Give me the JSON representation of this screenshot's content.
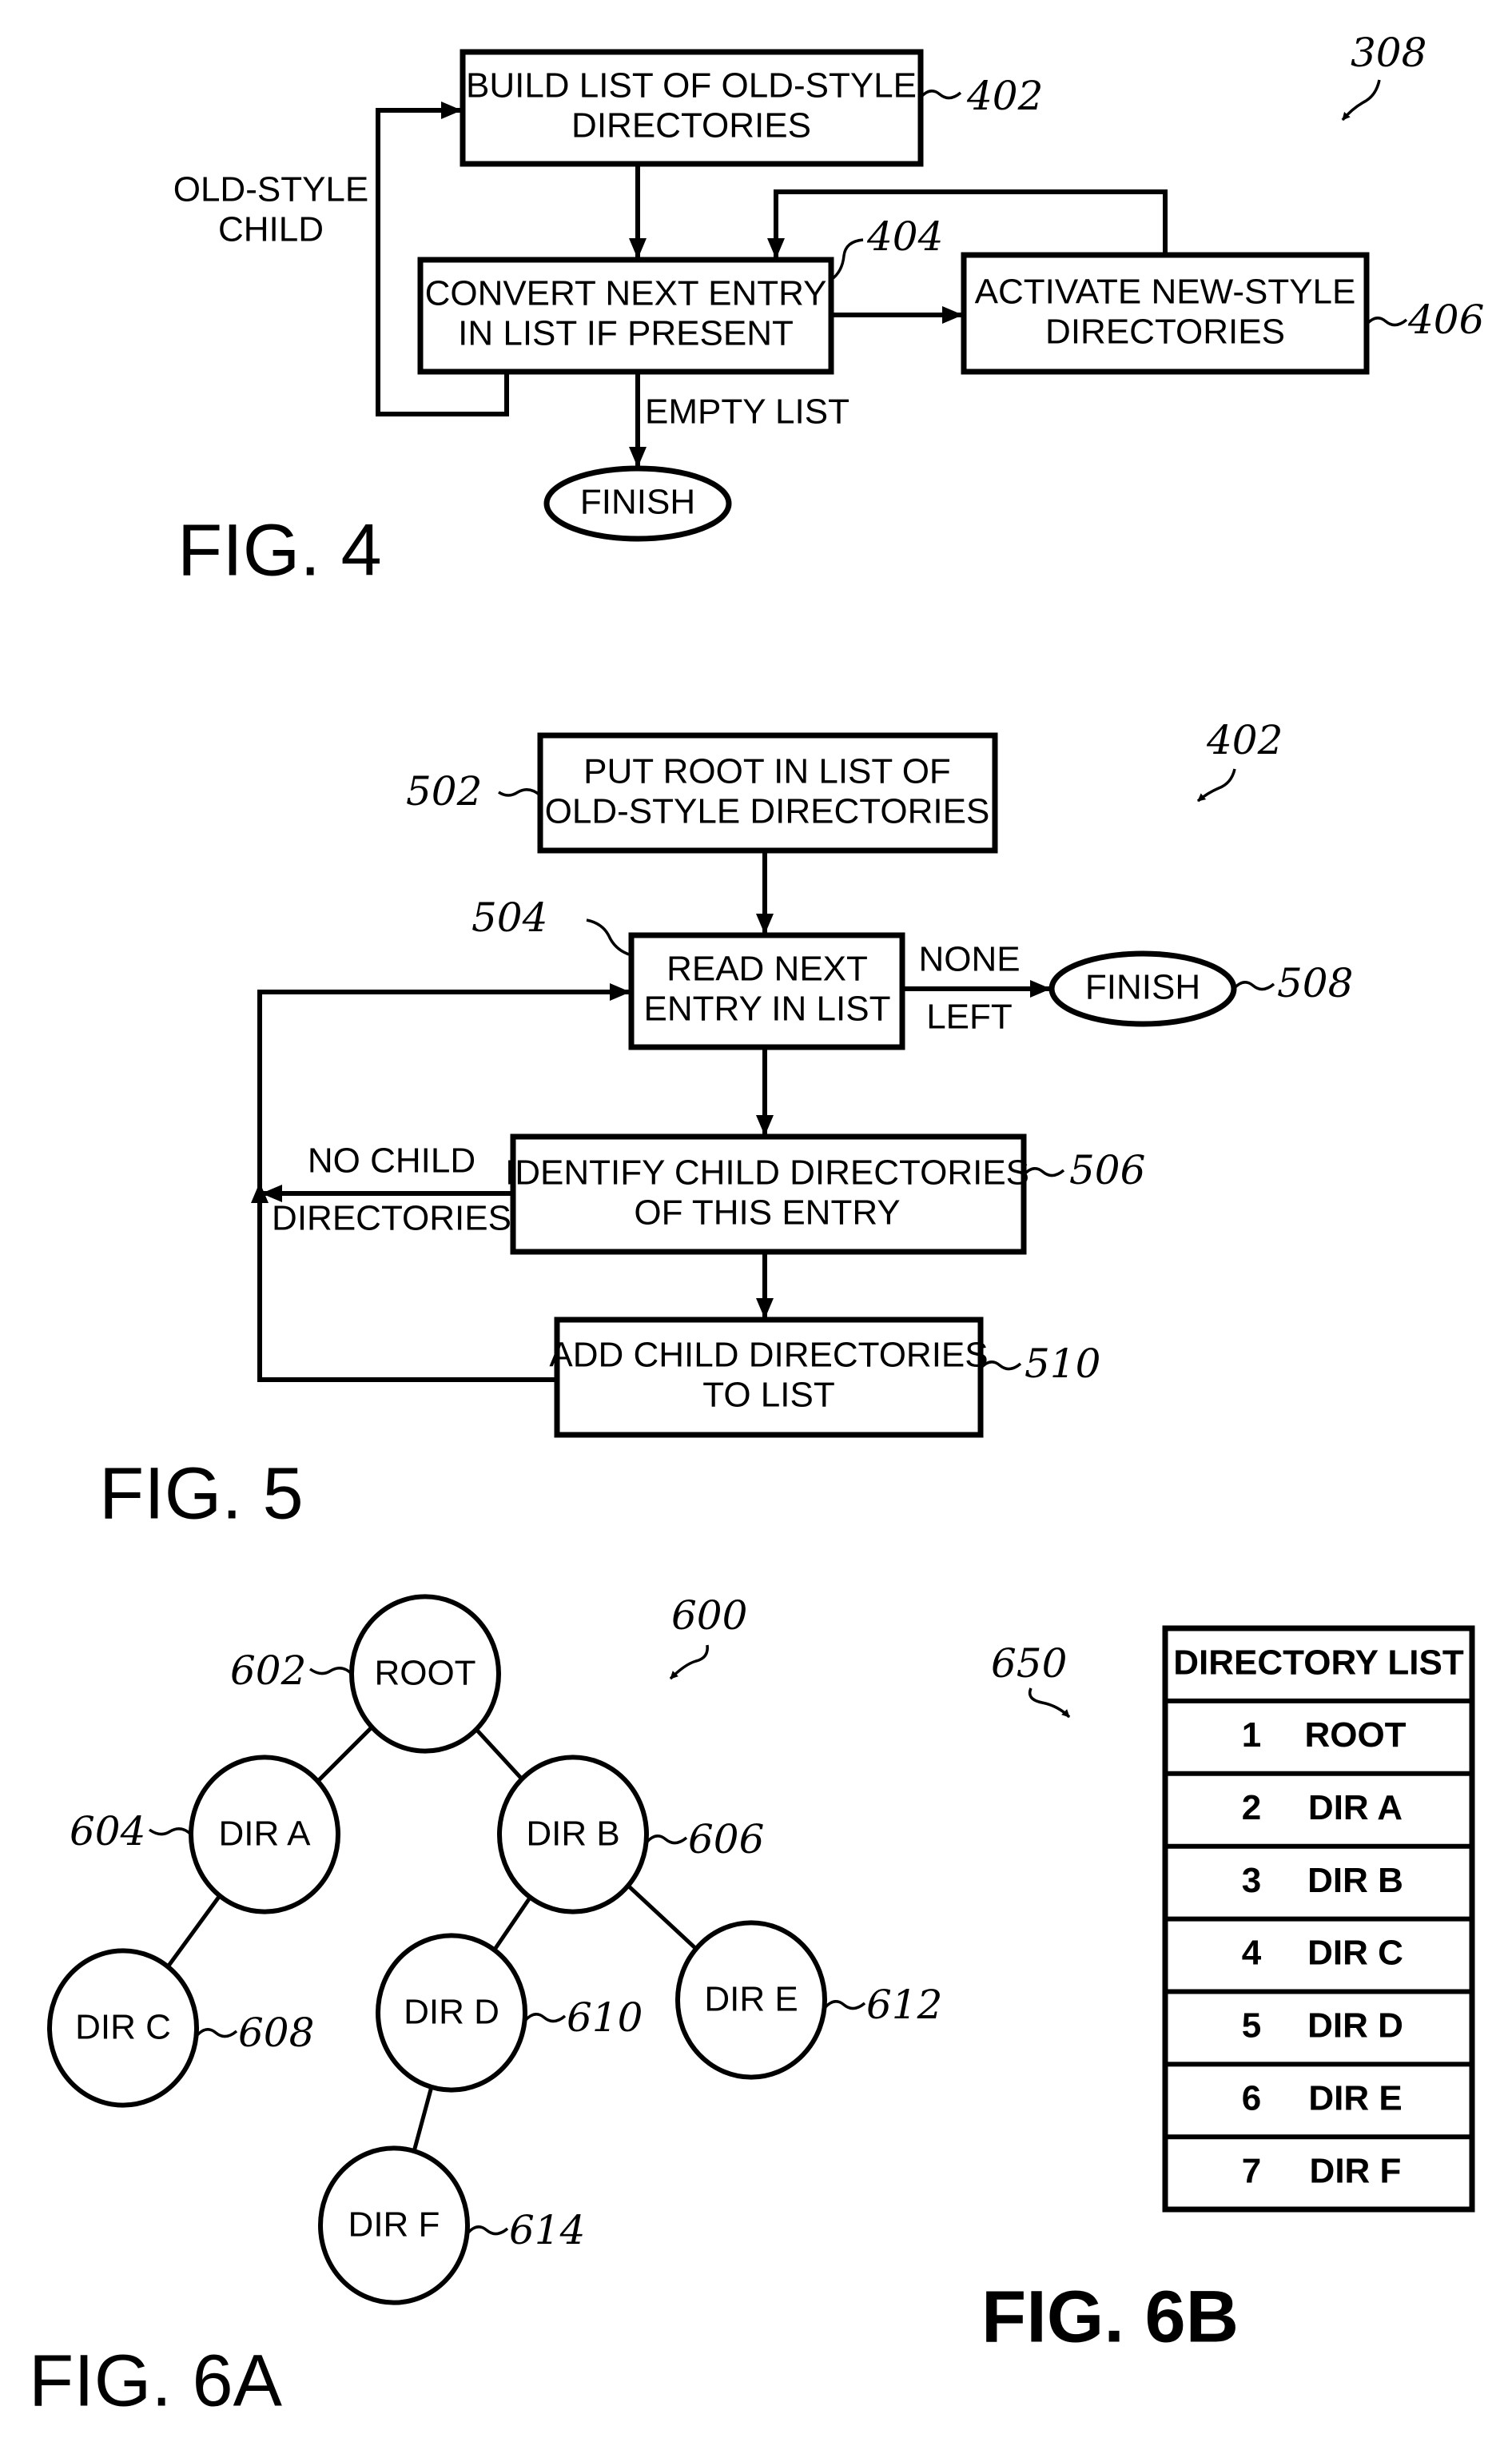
{
  "fig4": {
    "title": "FIG. 4",
    "ref": "308",
    "boxes": {
      "build": {
        "ref": "402",
        "lines": [
          "BUILD LIST OF OLD-STYLE",
          "DIRECTORIES"
        ]
      },
      "convert": {
        "ref": "404",
        "lines": [
          "CONVERT NEXT ENTRY",
          "IN LIST IF PRESENT"
        ]
      },
      "activate": {
        "ref": "406",
        "lines": [
          "ACTIVATE NEW-STYLE",
          "DIRECTORIES"
        ]
      }
    },
    "terminal": "FINISH",
    "edge_labels": {
      "loop": [
        "OLD-STYLE",
        "CHILD"
      ],
      "empty": "EMPTY LIST"
    }
  },
  "fig5": {
    "title": "FIG. 5",
    "ref": "402",
    "boxes": {
      "put_root": {
        "ref": "502",
        "lines": [
          "PUT ROOT IN LIST OF",
          "OLD-STYLE DIRECTORIES"
        ]
      },
      "read_next": {
        "ref": "504",
        "lines": [
          "READ NEXT",
          "ENTRY IN LIST"
        ]
      },
      "identify": {
        "ref": "506",
        "lines": [
          "IDENTIFY CHILD DIRECTORIES",
          "OF THIS ENTRY"
        ]
      },
      "add_child": {
        "ref": "510",
        "lines": [
          "ADD CHILD DIRECTORIES",
          "TO LIST"
        ]
      }
    },
    "terminal": {
      "ref": "508",
      "label": "FINISH"
    },
    "edge_labels": {
      "none_left": [
        "NONE",
        "LEFT"
      ],
      "no_child": [
        "NO CHILD",
        "DIRECTORIES"
      ]
    }
  },
  "fig6a": {
    "title": "FIG. 6A",
    "ref": "600",
    "nodes": [
      {
        "id": "root",
        "label": "ROOT",
        "ref": "602"
      },
      {
        "id": "a",
        "label": "DIR A",
        "ref": "604"
      },
      {
        "id": "b",
        "label": "DIR B",
        "ref": "606"
      },
      {
        "id": "c",
        "label": "DIR C",
        "ref": "608"
      },
      {
        "id": "d",
        "label": "DIR D",
        "ref": "610"
      },
      {
        "id": "e",
        "label": "DIR E",
        "ref": "612"
      },
      {
        "id": "f",
        "label": "DIR F",
        "ref": "614"
      }
    ],
    "edges": [
      [
        "root",
        "a"
      ],
      [
        "root",
        "b"
      ],
      [
        "a",
        "c"
      ],
      [
        "b",
        "d"
      ],
      [
        "b",
        "e"
      ],
      [
        "d",
        "f"
      ]
    ]
  },
  "fig6b": {
    "title": "FIG. 6B",
    "ref": "650",
    "header": "DIRECTORY LIST",
    "rows": [
      {
        "n": "1",
        "name": "ROOT"
      },
      {
        "n": "2",
        "name": "DIR A"
      },
      {
        "n": "3",
        "name": "DIR B"
      },
      {
        "n": "4",
        "name": "DIR C"
      },
      {
        "n": "5",
        "name": "DIR D"
      },
      {
        "n": "6",
        "name": "DIR E"
      },
      {
        "n": "7",
        "name": "DIR F"
      }
    ]
  }
}
